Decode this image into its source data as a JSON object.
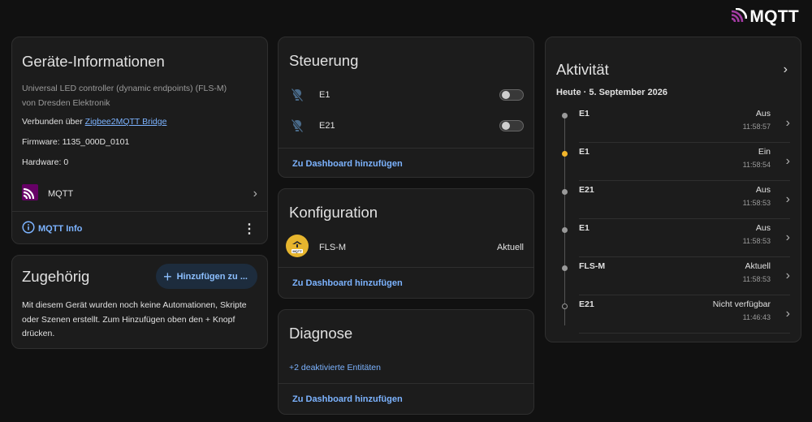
{
  "brand": {
    "logo_text": "MQTT",
    "icon": "mqtt-logo-icon"
  },
  "device_info": {
    "title": "Geräte-Informationen",
    "model": "Universal LED controller (dynamic endpoints) (FLS-M)",
    "manufacturer": "von Dresden Elektronik",
    "connected_prefix": "Verbunden über",
    "connected_link": "Zigbee2MQTT Bridge",
    "firmware": "Firmware: 1135_000D_0101",
    "hardware": "Hardware: 0",
    "integration_label": "MQTT",
    "info_link": "MQTT Info"
  },
  "related": {
    "title": "Zugehörig",
    "add_button": "Hinzufügen zu ...",
    "text": "Mit diesem Gerät wurden noch keine Automationen, Skripte oder Szenen erstellt. Zum Hinzufügen oben den + Knopf drücken."
  },
  "controls": {
    "title": "Steuerung",
    "entities": [
      {
        "name": "E1",
        "icon": "lightbulb-off-icon",
        "state": "off"
      },
      {
        "name": "E21",
        "icon": "lightbulb-off-icon",
        "state": "off"
      }
    ],
    "add_dashboard": "Zu Dashboard hinzufügen"
  },
  "configuration": {
    "title": "Konfiguration",
    "entity_name": "FLS-M",
    "entity_status": "Aktuell",
    "add_dashboard": "Zu Dashboard hinzufügen"
  },
  "diagnostics": {
    "title": "Diagnose",
    "disabled_entities": "+2 deaktivierte Entitäten",
    "add_dashboard": "Zu Dashboard hinzufügen"
  },
  "activity": {
    "title": "Aktivität",
    "date": "Heute · 5. September 2026",
    "entries": [
      {
        "name": "E1",
        "state": "Aus",
        "time": "11:58:57",
        "dot": "gray"
      },
      {
        "name": "E1",
        "state": "Ein",
        "time": "11:58:54",
        "dot": "yellow"
      },
      {
        "name": "E21",
        "state": "Aus",
        "time": "11:58:53",
        "dot": "gray"
      },
      {
        "name": "E1",
        "state": "Aus",
        "time": "11:58:53",
        "dot": "gray"
      },
      {
        "name": "FLS-M",
        "state": "Aktuell",
        "time": "11:58:53",
        "dot": "gray"
      },
      {
        "name": "E21",
        "state": "Nicht verfügbar",
        "time": "11:46:43",
        "dot": "hollow"
      }
    ]
  },
  "colors": {
    "background": "#111111",
    "card": "#1c1c1c",
    "accent_link": "#7cb3ff",
    "active_dot": "#f2b52a",
    "mqtt_purple": "#660066"
  }
}
